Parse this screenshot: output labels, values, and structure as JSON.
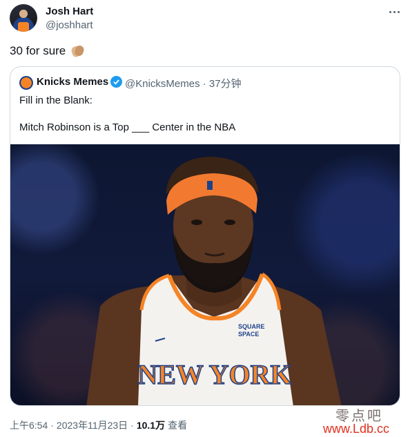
{
  "author": {
    "name": "Josh Hart",
    "handle": "@joshhart"
  },
  "tweet": {
    "text": "30 for sure",
    "emoji_icon": "clapping-hands-icon"
  },
  "quoted": {
    "name": "Knicks Memes",
    "meta": "@KnicksMemes · 37分钟",
    "line1": "Fill in the Blank:",
    "line2": "Mitch Robinson is a Top ___ Center in the NBA",
    "jersey_text": "NEW YORK",
    "sponsor_line1": "SQUARE",
    "sponsor_line2": "SPACE"
  },
  "footer": {
    "time": "上午6:54",
    "date": "2023年11月23日",
    "views_count": "10.1万",
    "views_label": "查看"
  },
  "watermark": {
    "top": "零点吧",
    "bottom": "www.Ldb.cc"
  },
  "colors": {
    "accent": "#1d9bf0",
    "knicks_orange": "#f58426",
    "knicks_blue": "#1d428a"
  }
}
